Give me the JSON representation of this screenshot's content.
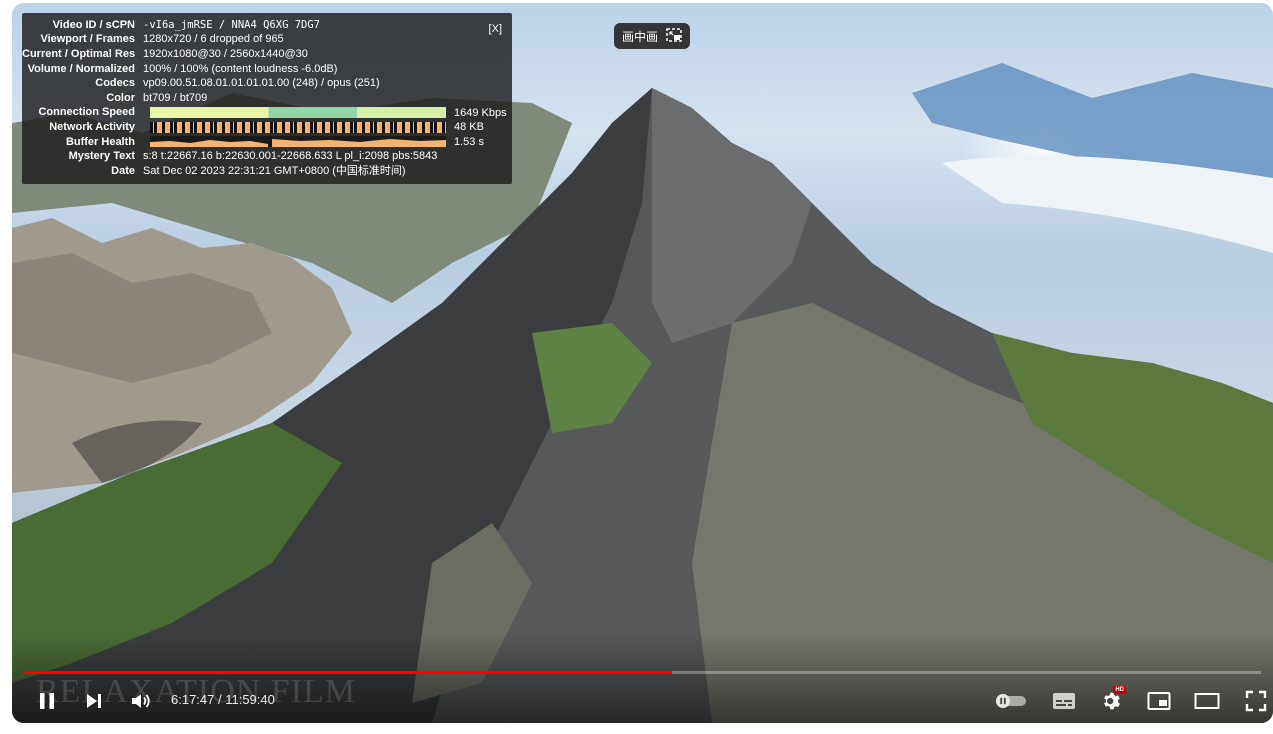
{
  "stats": {
    "close_label": "[X]",
    "rows": [
      {
        "label": "Video ID / sCPN",
        "value": "-vI6a_jmRSE  /  NNA4 Q6XG 7DG7"
      },
      {
        "label": "Viewport / Frames",
        "value": "1280x720 / 6 dropped of 965"
      },
      {
        "label": "Current / Optimal Res",
        "value": "1920x1080@30 / 2560x1440@30"
      },
      {
        "label": "Volume / Normalized",
        "value": "100% / 100% (content loudness -6.0dB)"
      },
      {
        "label": "Codecs",
        "value": "vp09.00.51.08.01.01.01.01.00 (248) / opus (251)"
      },
      {
        "label": "Color",
        "value": "bt709 / bt709"
      },
      {
        "label": "Connection Speed",
        "value": "1649 Kbps"
      },
      {
        "label": "Network Activity",
        "value": "48 KB"
      },
      {
        "label": "Buffer Health",
        "value": "1.53 s"
      },
      {
        "label": "Mystery Text",
        "value": "s:8 t:22667.16 b:22630.001-22668.633 L pl_i:2098 pbs:5843"
      },
      {
        "label": "Date",
        "value": "Sat Dec 02 2023 22:31:21 GMT+0800 (中国标准时间)"
      }
    ]
  },
  "pip_pill": {
    "label": "画中画"
  },
  "watermark": "RELAXATION FILM",
  "player": {
    "current_time": "6:17:47",
    "duration": "11:59:40",
    "time_display": "6:17:47 / 11:59:40",
    "progress_fraction": 0.524,
    "quality_badge": "HD"
  },
  "colors": {
    "progress_played": "#ff0000",
    "stats_bg": "#1c1c1c"
  },
  "icons": {
    "pause": "pause-icon",
    "next": "next-icon",
    "volume": "volume-icon",
    "autoplay": "autoplay-toggle-icon",
    "subtitles": "subtitles-icon",
    "settings": "gear-icon",
    "miniplayer": "miniplayer-icon",
    "theater": "theater-mode-icon",
    "fullscreen": "fullscreen-icon"
  }
}
